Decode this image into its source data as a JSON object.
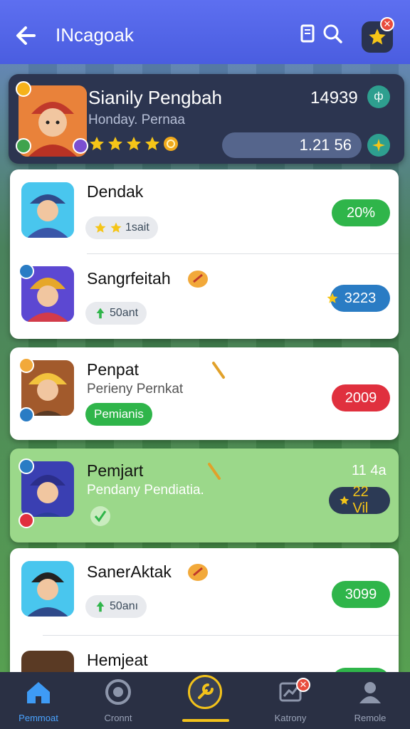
{
  "header": {
    "title": "INcagoak",
    "back_icon": "arrow-left-icon",
    "doc_icon": "document-icon",
    "search_icon": "search-icon",
    "fav_icon": "star-icon",
    "fav_badge": "✕"
  },
  "top_player": {
    "name": "Sianily Pengbah",
    "subtitle": "Honday. Pernaa",
    "score": "14939",
    "bar_value": "1.21 56",
    "stars": 4,
    "score_icon": "glyph-icon",
    "bar_icon": "sparkle-icon"
  },
  "players": [
    {
      "name": "Dendak",
      "chip": "1sait",
      "value": "20%",
      "value_color": "green",
      "chip_icon": "star-icon"
    },
    {
      "name": "Sangrfeitah",
      "chip": "50ant",
      "value": "3223",
      "value_color": "blue",
      "chip_icon": "thumb-icon"
    },
    {
      "name": "Penpat",
      "subtitle": "Perieny Pernkat",
      "chip": "Pemianis",
      "value": "2009",
      "value_color": "red"
    },
    {
      "name": "Pemjart",
      "subtitle": "Pendany Pendiatia.",
      "top_right": "11 4a",
      "value": "22 Vil",
      "value_color": "dark"
    },
    {
      "name": "SanerAktak",
      "chip": "50anı",
      "value": "3099",
      "value_color": "green",
      "chip_icon": "thumb-icon"
    },
    {
      "name": "Hemjeat"
    }
  ],
  "nav": {
    "items": [
      {
        "label": "Pemmoat",
        "icon": "home-icon",
        "active": true
      },
      {
        "label": "Cronnt",
        "icon": "target-icon"
      },
      {
        "label": "",
        "icon": "wrench-icon"
      },
      {
        "label": "Katrony",
        "icon": "chart-icon",
        "badge": "✕"
      },
      {
        "label": "Remole",
        "icon": "user-icon"
      }
    ]
  },
  "colors": {
    "header": "#5d6ff0",
    "accent_green": "#2fb54a",
    "accent_blue": "#2a7cc4",
    "accent_red": "#e0303e",
    "highlight_row": "#9bd88a",
    "nav_bg": "#2a3044"
  }
}
